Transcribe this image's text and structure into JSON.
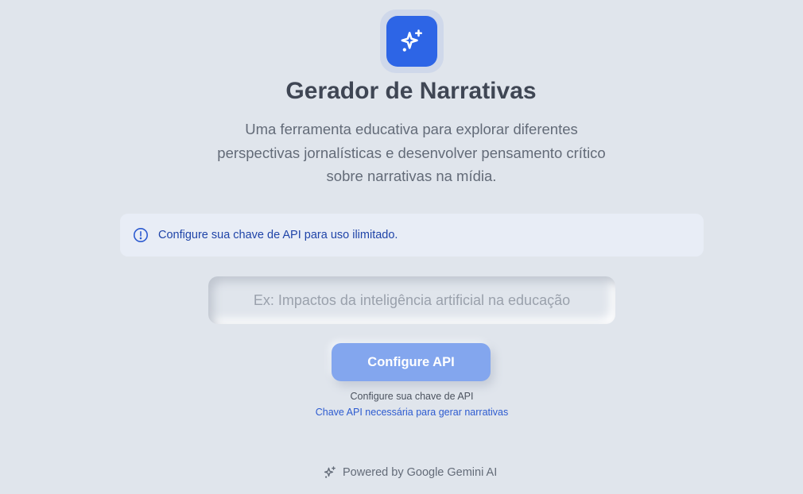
{
  "header": {
    "logo_icon": "sparkles-icon",
    "title": "Gerador de Narrativas",
    "subtitle": "Uma ferramenta educativa para explorar diferentes perspectivas jornalísticas e desenvolver pensamento crítico sobre narrativas na mídia."
  },
  "alert": {
    "icon": "info-circle-icon",
    "text": "Configure sua chave de API para uso ilimitado."
  },
  "topic_input": {
    "value": "",
    "placeholder": "Ex: Impactos da inteligência artificial na educação"
  },
  "actions": {
    "configure_label": "Configure API",
    "hint_primary": "Configure sua chave de API",
    "hint_secondary": "Chave API necessária para gerar narrativas"
  },
  "footer": {
    "icon": "sparkles-icon",
    "text": "Powered by Google Gemini AI"
  },
  "colors": {
    "background": "#e0e5ec",
    "accent": "#2d65e6",
    "button": "#83a6ee",
    "alert_text": "#1f44a8",
    "link": "#2d5bd0"
  }
}
